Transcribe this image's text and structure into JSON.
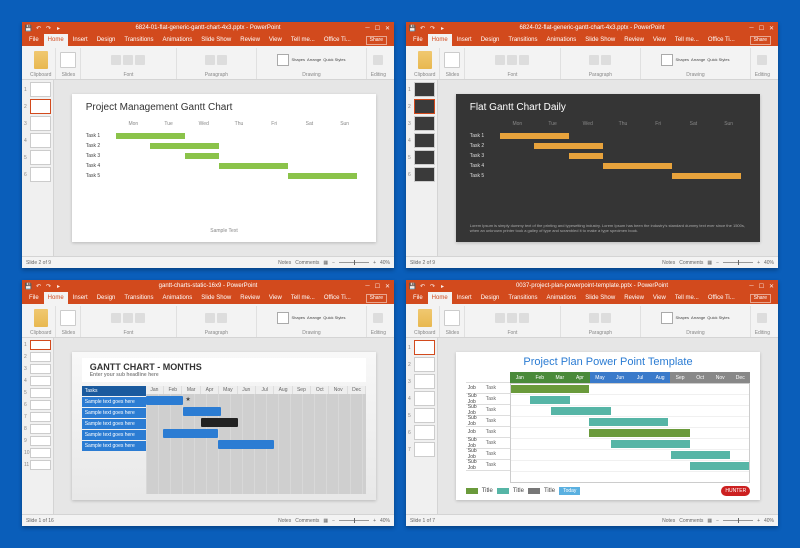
{
  "windows": [
    {
      "title": "6824-01-flat-generic-gantt-chart-4x3.pptx - PowerPoint",
      "slide_counter": "Slide 2 of 9",
      "zoom": "40%",
      "slide": {
        "title": "Project Management Gantt Chart",
        "days": [
          "Mon",
          "Tue",
          "Wed",
          "Thu",
          "Fri",
          "Sat",
          "Sun"
        ],
        "tasks": [
          "Task 1",
          "Task 2",
          "Task 3",
          "Task 4",
          "Task 5"
        ],
        "footer": "Sample Text"
      }
    },
    {
      "title": "6824-02-flat-generic-gantt-chart-4x3.pptx - PowerPoint",
      "slide_counter": "Slide 2 of 9",
      "zoom": "40%",
      "slide": {
        "title": "Flat Gantt Chart Daily",
        "days": [
          "Mon",
          "Tue",
          "Wed",
          "Thu",
          "Fri",
          "Sat",
          "Sun"
        ],
        "tasks": [
          "Task 1",
          "Task 2",
          "Task 3",
          "Task 4",
          "Task 5"
        ],
        "lorem": "Lorem Ipsum is simply dummy text of the printing and typesetting industry. Lorem Ipsum has been the industry's standard dummy text ever since the 1500s, when an unknown printer took a galley of type and scrambled it to make a type specimen book."
      }
    },
    {
      "title": "gantt-charts-static-16x9 - PowerPoint",
      "slide_counter": "Slide 1 of 16",
      "zoom": "40%",
      "slide": {
        "title": "GANTT CHART - MONTHS",
        "subtitle": "Enter your sub headline here",
        "task_hdr": "Tasks",
        "tasks": [
          "Sample text goes here",
          "Sample text goes here",
          "Sample text goes here",
          "Sample text goes here",
          "Sample text goes here"
        ],
        "months": [
          "Jan",
          "Feb",
          "Mar",
          "Apr",
          "May",
          "Jun",
          "Jul",
          "Aug",
          "Sep",
          "Oct",
          "Nov",
          "Dec"
        ]
      }
    },
    {
      "title": "0037-project-plan-powerpoint-template.pptx - PowerPoint",
      "slide_counter": "Slide 1 of 7",
      "zoom": "40%",
      "slide": {
        "title": "Project Plan Power Point Template",
        "rows": [
          [
            "Job",
            "Task"
          ],
          [
            "Sub Job",
            "Task"
          ],
          [
            "Sub Job",
            "Task"
          ],
          [
            "Sub Job",
            "Task"
          ],
          [
            "Job",
            "Task"
          ],
          [
            "Sub Job",
            "Task"
          ],
          [
            "Sub Job",
            "Task"
          ],
          [
            "Sub Job",
            "Task"
          ]
        ],
        "months": [
          "Jan",
          "Feb",
          "Mar",
          "Apr",
          "May",
          "Jun",
          "Jul",
          "Aug",
          "Sep",
          "Oct",
          "Nov",
          "Dec"
        ],
        "legend": [
          "Title",
          "Title",
          "Title"
        ],
        "today": "Today",
        "badge": "HUNTER"
      }
    }
  ],
  "ribbon": {
    "tabs": [
      "File",
      "Home",
      "Insert",
      "Design",
      "Transitions",
      "Animations",
      "Slide Show",
      "Review",
      "View",
      "Tell me...",
      "Office Ti...",
      "Share"
    ],
    "groups": [
      "Clipboard",
      "Slides",
      "Font",
      "Paragraph",
      "Drawing",
      "Editing"
    ],
    "paste": "Paste",
    "newslide": "New Slide",
    "shapes": "Shapes",
    "arrange": "Arrange",
    "quick": "Quick Styles"
  },
  "status": {
    "notes": "Notes",
    "comments": "Comments"
  },
  "chart_data": [
    {
      "type": "bar",
      "title": "Project Management Gantt Chart",
      "categories": [
        "Mon",
        "Tue",
        "Wed",
        "Thu",
        "Fri",
        "Sat",
        "Sun"
      ],
      "series": [
        {
          "name": "Task 1",
          "start": 0,
          "duration": 2
        },
        {
          "name": "Task 2",
          "start": 1,
          "duration": 2
        },
        {
          "name": "Task 3",
          "start": 2,
          "duration": 1
        },
        {
          "name": "Task 4",
          "start": 3,
          "duration": 2
        },
        {
          "name": "Task 5",
          "start": 5,
          "duration": 2
        }
      ]
    },
    {
      "type": "bar",
      "title": "Flat Gantt Chart Daily",
      "categories": [
        "Mon",
        "Tue",
        "Wed",
        "Thu",
        "Fri",
        "Sat",
        "Sun"
      ],
      "series": [
        {
          "name": "Task 1",
          "start": 0,
          "duration": 2
        },
        {
          "name": "Task 2",
          "start": 1,
          "duration": 2
        },
        {
          "name": "Task 3",
          "start": 2,
          "duration": 1
        },
        {
          "name": "Task 4",
          "start": 3,
          "duration": 2
        },
        {
          "name": "Task 5",
          "start": 5,
          "duration": 2
        }
      ]
    },
    {
      "type": "bar",
      "title": "GANTT CHART - MONTHS",
      "categories": [
        "Jan",
        "Feb",
        "Mar",
        "Apr",
        "May",
        "Jun",
        "Jul",
        "Aug",
        "Sep",
        "Oct",
        "Nov",
        "Dec"
      ],
      "series": [
        {
          "name": "Sample text goes here",
          "start": 0,
          "duration": 2,
          "color": "blue"
        },
        {
          "name": "Sample text goes here",
          "start": 2,
          "duration": 2,
          "color": "blue"
        },
        {
          "name": "Sample text goes here",
          "start": 3,
          "duration": 2,
          "color": "black"
        },
        {
          "name": "Sample text goes here",
          "start": 1,
          "duration": 3,
          "color": "blue"
        },
        {
          "name": "Sample text goes here",
          "start": 4,
          "duration": 3,
          "color": "blue"
        }
      ]
    },
    {
      "type": "bar",
      "title": "Project Plan Power Point Template",
      "categories": [
        "Jan",
        "Feb",
        "Mar",
        "Apr",
        "May",
        "Jun",
        "Jul",
        "Aug",
        "Sep",
        "Oct",
        "Nov",
        "Dec"
      ],
      "series": [
        {
          "name": "Job Task",
          "start": 0,
          "duration": 4,
          "color": "green"
        },
        {
          "name": "Sub Job Task",
          "start": 1,
          "duration": 2,
          "color": "teal"
        },
        {
          "name": "Sub Job Task",
          "start": 2,
          "duration": 3,
          "color": "teal"
        },
        {
          "name": "Sub Job Task",
          "start": 4,
          "duration": 4,
          "color": "teal"
        },
        {
          "name": "Job Task",
          "start": 4,
          "duration": 5,
          "color": "green"
        },
        {
          "name": "Sub Job Task",
          "start": 5,
          "duration": 4,
          "color": "teal"
        },
        {
          "name": "Sub Job Task",
          "start": 8,
          "duration": 3,
          "color": "teal"
        },
        {
          "name": "Sub Job Task",
          "start": 9,
          "duration": 3,
          "color": "teal"
        }
      ]
    }
  ]
}
